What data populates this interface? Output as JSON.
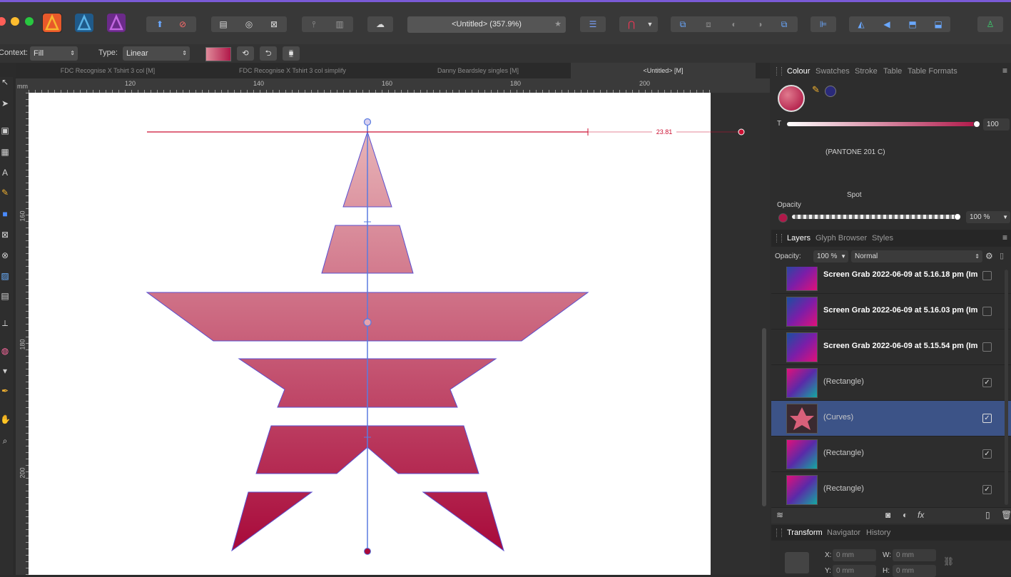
{
  "colors": {
    "accent": "#7a5ad6",
    "guide": "#5a7be0",
    "measure": "#cc1133",
    "selected_layer": "#3c5387",
    "spot": "#b01849"
  },
  "toolbar": {
    "title": "<Untitled> (357.9%)",
    "star": "★",
    "icons": [
      "designer-icon",
      "photo-icon",
      "publisher-icon",
      "share-icon",
      "sync-icon",
      "page-icon",
      "spread-icon",
      "frame-icon",
      "pin-icon",
      "master-icon",
      "view-mode-icon",
      "baseline-grid-icon",
      "snapping-icon",
      "arrange-icon",
      "align-icon",
      "flip-icon"
    ]
  },
  "context": {
    "context_label": "Context:",
    "context_value": "Fill",
    "type_label": "Type:",
    "type_value": "Linear"
  },
  "tabs": [
    "FDC Recognise X Tshirt 3 col [M]",
    "FDC Recognise X Tshirt 3 col simplify",
    "Danny Beardsley singles [M]",
    "<Untitled> [M]"
  ],
  "ruler": {
    "unit": "mm",
    "h": [
      "120",
      "140",
      "160",
      "180",
      "200"
    ],
    "v": [
      "160",
      "180",
      "200"
    ]
  },
  "measure": {
    "value": "23.81"
  },
  "colour_panel": {
    "tabs": [
      "Colour",
      "Swatches",
      "Stroke",
      "Table",
      "Table Formats"
    ],
    "t_label": "T",
    "t_value": "100",
    "pantone": "(PANTONE 201 C)",
    "spot": "Spot",
    "opacity_label": "Opacity",
    "opacity_value": "100 %"
  },
  "layers_panel": {
    "tabs": [
      "Layers",
      "Glyph Browser",
      "Styles"
    ],
    "opacity_label": "Opacity:",
    "opacity_value": "100 %",
    "blend": "Normal",
    "layers": [
      {
        "name": "Screen Grab 2022-06-09 at 5.16.18 pm (Im",
        "checked": false
      },
      {
        "name": "Screen Grab 2022-06-09 at 5.16.03 pm (Im",
        "checked": false
      },
      {
        "name": "Screen Grab 2022-06-09 at 5.15.54 pm (Im",
        "checked": false
      },
      {
        "name": "(Rectangle)",
        "checked": true
      },
      {
        "name": "(Curves)",
        "checked": true
      },
      {
        "name": "(Rectangle)",
        "checked": true
      },
      {
        "name": "(Rectangle)",
        "checked": true
      }
    ],
    "fx": "fx"
  },
  "transform_panel": {
    "tabs": [
      "Transform",
      "Navigator",
      "History"
    ],
    "x_label": "X:",
    "x_value": "0 mm",
    "w_label": "W:",
    "w_value": "0 mm",
    "y_label": "Y:",
    "y_value": "0 mm",
    "h_label": "H:",
    "h_value": "0 mm"
  }
}
